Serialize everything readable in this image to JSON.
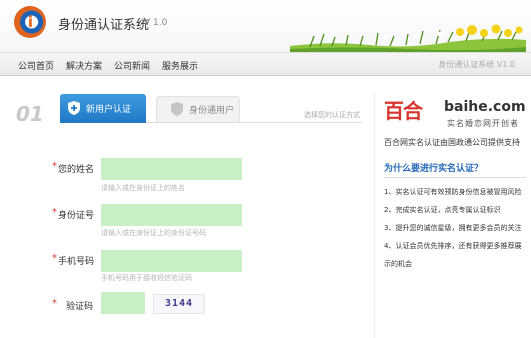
{
  "header": {
    "title": "身份通认证系统",
    "version": "V 1.0"
  },
  "nav": {
    "items": [
      "公司首页",
      "解决方案",
      "公司新闻",
      "服务展示"
    ],
    "right_text": "身份通认证系统 V1.0"
  },
  "steps": {
    "number": "01",
    "tab_active": "新用户认证",
    "tab_inactive": "身份通用户",
    "note": "选择您的认证方式"
  },
  "form": {
    "fields": [
      {
        "label": "您的姓名",
        "hint": "请输入或在身份证上的姓名"
      },
      {
        "label": "身份证号",
        "hint": "请输入或在身份证上的身份证号码"
      },
      {
        "label": "手机号码",
        "hint": "手机号码用于接收短信验证码"
      }
    ],
    "captcha_label": "验证码",
    "captcha_text": "3144",
    "required_mark": "*"
  },
  "side": {
    "logo_cn": "百合",
    "logo_en": "baihe.com",
    "logo_slogan": "实名婚恋网开创者",
    "provider": "百合网实名认证由国政通公司提供支持",
    "heading": "为什么要进行实名认证？",
    "reasons": [
      "1、实名认证可有效预防身份信息被冒用风险",
      "2、完成实名认证，点亮专属认证标识",
      "3、提升您的诚信星级，拥有更多会员的关注",
      "4、认证会员优先排序，还有获得更多推荐展示的机会"
    ]
  },
  "colors": {
    "accent_blue": "#1f78c6",
    "input_green": "#c9efc7",
    "required_red": "#d33333",
    "brand_orange": "#e0641e",
    "baihe_red": "#d9342b"
  }
}
